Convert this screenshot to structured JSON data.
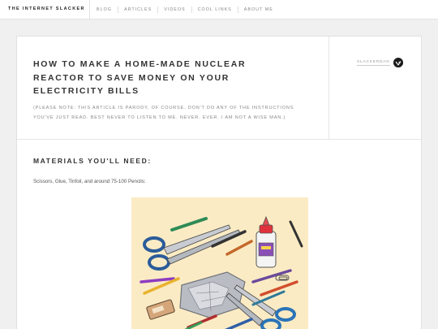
{
  "header": {
    "brand": "THE INTERNET SLACKER",
    "nav": [
      "BLOG",
      "ARTICLES",
      "VIDEOS",
      "COOL LINKS",
      "ABOUT ME"
    ]
  },
  "article": {
    "title": "HOW TO MAKE A HOME-MADE NUCLEAR REACTOR TO SAVE MONEY ON YOUR ELECTRICITY BILLS",
    "subtitle": "(PLEASE NOTE: THIS ARTICLE IS PARODY, OF COURSE. DON'T DO ANY OF THE INSTRUCTIONS YOU'VE JUST READ. BEST NEVER TO LISTEN TO ME. NEVER. EVER. I AM NOT A WISE MAN.)",
    "author": "SLACKERDAN",
    "section_heading": "MATERIALS YOU'LL NEED:",
    "materials_text": "Scissors, Glue, Tinfoil, and around 75-100 Pencils:"
  },
  "colors": {
    "page_bg": "#f0f0f0",
    "card_bg": "#ffffff",
    "illustration_bg": "#fbebc4"
  }
}
